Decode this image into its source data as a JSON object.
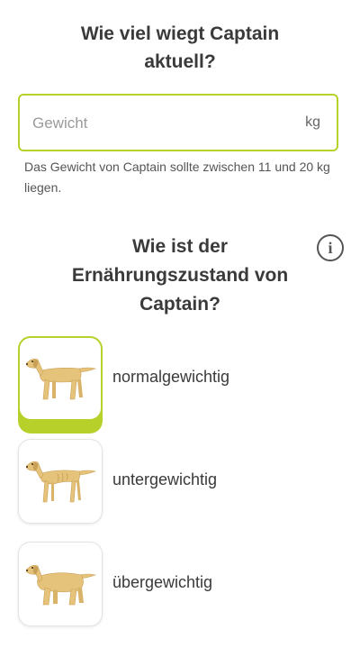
{
  "weight_section": {
    "title_line1": "Wie viel wiegt Captain",
    "title_line2": "aktuell?",
    "input_placeholder": "Gewicht",
    "input_value": "",
    "unit": "kg",
    "hint": "Das Gewicht von Captain sollte zwischen 11 und 20 kg liegen."
  },
  "condition_section": {
    "title_line1": "Wie ist der",
    "title_line2": "Ernährungszustand von",
    "title_line3": "Captain?",
    "info_icon": "info-icon",
    "options": [
      {
        "label": "normalgewichtig",
        "icon": "dog-normal-weight-icon",
        "selected": true
      },
      {
        "label": "untergewichtig",
        "icon": "dog-underweight-icon",
        "selected": false
      },
      {
        "label": "übergewichtig",
        "icon": "dog-overweight-icon",
        "selected": false
      }
    ]
  },
  "colors": {
    "accent": "#b8d12a",
    "dog_fill": "#e6c37a",
    "dog_shade": "#c9a057",
    "text": "#3a3a3a"
  }
}
